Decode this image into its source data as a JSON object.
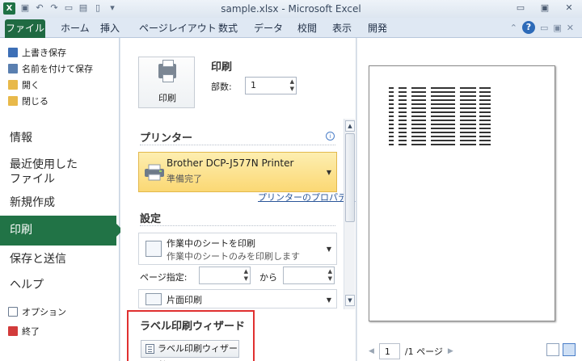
{
  "window": {
    "title": "sample.xlsx - Microsoft Excel",
    "app_letter": "X"
  },
  "ribbon": {
    "file_tab": "ファイル",
    "tabs": [
      "ホーム",
      "挿入",
      "ページレイアウト",
      "数式",
      "データ",
      "校閲",
      "表示",
      "開発"
    ],
    "help": "?"
  },
  "nav": {
    "save": "上書き保存",
    "save_as": "名前を付けて保存",
    "open": "開く",
    "close": "閉じる",
    "info": "情報",
    "recent_line1": "最近使用した",
    "recent_line2": "ファイル",
    "new": "新規作成",
    "print": "印刷",
    "save_send": "保存と送信",
    "help": "ヘルプ",
    "options": "オプション",
    "exit": "終了"
  },
  "print_panel": {
    "print_button": "印刷",
    "heading": "印刷",
    "copies_label": "部数:",
    "copies_value": "1",
    "printer_heading": "プリンター",
    "printer_name": "Brother DCP-J577N Printer",
    "printer_status": "準備完了",
    "printer_properties": "プリンターのプロパティ",
    "settings_heading": "設定",
    "scope_title": "作業中のシートを印刷",
    "scope_desc": "作業中のシートのみを印刷します",
    "pages_label": "ページ指定:",
    "pages_to": "から",
    "pages_from_value": "",
    "pages_to_value": "",
    "duplex": "片面印刷",
    "wizard_heading": "ラベル印刷ウィザード",
    "wizard_button": "ラベル印刷ウィザード"
  },
  "preview": {
    "current_page": "1",
    "page_total": "/1 ページ"
  },
  "colors": {
    "accent_green": "#217346",
    "printer_highlight": "#fbd874",
    "wizard_frame": "#e03030",
    "link": "#2a5699"
  }
}
